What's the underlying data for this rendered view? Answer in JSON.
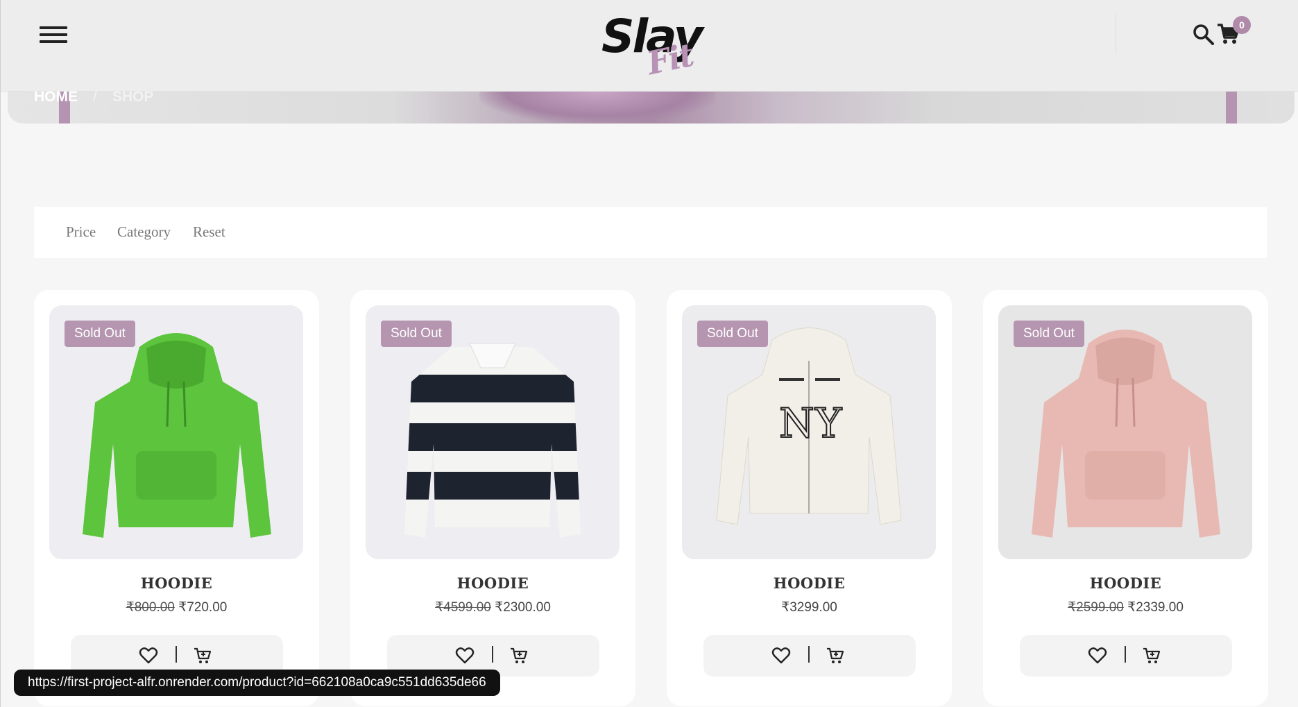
{
  "header": {
    "logo_main": "Slay",
    "logo_sub": "Fit",
    "cart_count": "0"
  },
  "breadcrumb": {
    "home": "HOME",
    "separator": "/",
    "current": "SHOP"
  },
  "filters": {
    "price": "Price",
    "category": "Category",
    "reset": "Reset"
  },
  "products": [
    {
      "badge": "Sold Out",
      "name": "HOODIE",
      "old_price": "₹800.00",
      "price": "₹720.00",
      "color": "#5cc43d"
    },
    {
      "badge": "Sold Out",
      "name": "HOODIE",
      "old_price": "₹4599.00",
      "price": "₹2300.00",
      "color": "#1e2330"
    },
    {
      "badge": "Sold Out",
      "name": "HOODIE",
      "old_price": "",
      "price": "₹3299.00",
      "color": "#f2efe8"
    },
    {
      "badge": "Sold Out",
      "name": "HOODIE",
      "old_price": "₹2599.00",
      "price": "₹2339.00",
      "color": "#e8b9b3"
    }
  ],
  "status_url": "https://first-project-alfr.onrender.com/product?id=662108a0ca9c551dd635de66",
  "colors": {
    "accent": "#b595b0",
    "background": "#f6f6f7"
  }
}
